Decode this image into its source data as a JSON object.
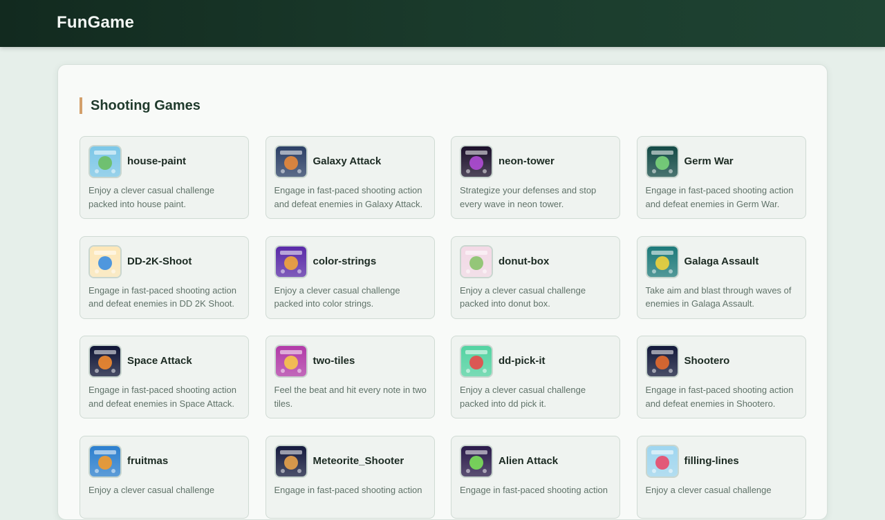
{
  "site": {
    "logo": "FunGame"
  },
  "section": {
    "title": "Shooting Games"
  },
  "games": [
    {
      "name": "house-paint",
      "desc": "Enjoy a clever casual challenge packed into house paint.",
      "icon": "house-paint-thumbnail",
      "colors": [
        "#7cc7e8",
        "#6bbf63"
      ]
    },
    {
      "name": "Galaxy Attack",
      "desc": "Engage in fast-paced shooting action and defeat enemies in Galaxy Attack.",
      "icon": "galaxy-attack-thumbnail",
      "colors": [
        "#2b3f66",
        "#e7883a"
      ]
    },
    {
      "name": "neon-tower",
      "desc": "Strategize your defenses and stop every wave in neon tower.",
      "icon": "neon-tower-thumbnail",
      "colors": [
        "#1b0f2a",
        "#b04cd6"
      ]
    },
    {
      "name": "Germ War",
      "desc": "Engage in fast-paced shooting action and defeat enemies in Germ War.",
      "icon": "germ-war-thumbnail",
      "colors": [
        "#134a46",
        "#7ad37a"
      ]
    },
    {
      "name": "DD-2K-Shoot",
      "desc": "Engage in fast-paced shooting action and defeat enemies in DD 2K Shoot.",
      "icon": "dd-2k-shoot-thumbnail",
      "colors": [
        "#fde7b8",
        "#3c8ee0"
      ]
    },
    {
      "name": "color-strings",
      "desc": "Enjoy a clever casual challenge packed into color strings.",
      "icon": "color-strings-thumbnail",
      "colors": [
        "#5a2aa8",
        "#f2a53a"
      ]
    },
    {
      "name": "donut-box",
      "desc": "Enjoy a clever casual challenge packed into donut box.",
      "icon": "donut-box-thumbnail",
      "colors": [
        "#f3d9e6",
        "#8ac36b"
      ]
    },
    {
      "name": "Galaga Assault",
      "desc": "Take aim and blast through waves of enemies in Galaga Assault.",
      "icon": "galaga-assault-thumbnail",
      "colors": [
        "#1d7a7a",
        "#f0d23c"
      ]
    },
    {
      "name": "Space Attack",
      "desc": "Engage in fast-paced shooting action and defeat enemies in Space Attack.",
      "icon": "space-attack-thumbnail",
      "colors": [
        "#0f1436",
        "#f28a2f"
      ]
    },
    {
      "name": "two-tiles",
      "desc": "Feel the beat and hit every note in two tiles.",
      "icon": "two-tiles-thumbnail",
      "colors": [
        "#b23aa8",
        "#f7c64a"
      ]
    },
    {
      "name": "dd-pick-it",
      "desc": "Enjoy a clever casual challenge packed into dd pick it.",
      "icon": "dd-pick-it-thumbnail",
      "colors": [
        "#53d3a2",
        "#e84a4a"
      ]
    },
    {
      "name": "Shootero",
      "desc": "Engage in fast-paced shooting action and defeat enemies in Shootero.",
      "icon": "shootero-thumbnail",
      "colors": [
        "#12183a",
        "#e36a2e"
      ]
    },
    {
      "name": "fruitmas",
      "desc": "Enjoy a clever casual challenge",
      "icon": "fruitmas-thumbnail",
      "colors": [
        "#2c7fcf",
        "#f39a2c"
      ]
    },
    {
      "name": "Meteorite_Shooter",
      "desc": "Engage in fast-paced shooting action",
      "icon": "meteorite-shooter-thumbnail",
      "colors": [
        "#151a3e",
        "#e8a24a"
      ]
    },
    {
      "name": "Alien Attack",
      "desc": "Engage in fast-paced shooting action",
      "icon": "alien-attack-thumbnail",
      "colors": [
        "#2a1a4a",
        "#7be05a"
      ]
    },
    {
      "name": "filling-lines",
      "desc": "Enjoy a clever casual challenge",
      "icon": "filling-lines-thumbnail",
      "colors": [
        "#9fd6f0",
        "#e84a6a"
      ]
    }
  ]
}
